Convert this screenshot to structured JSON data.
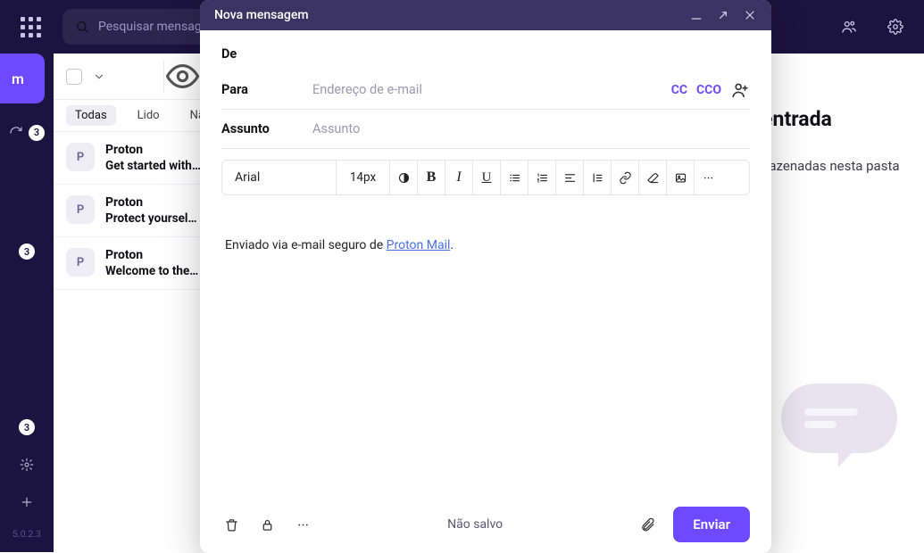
{
  "topbar": {
    "search_placeholder": "Pesquisar mensagens"
  },
  "sidebar": {
    "compose_label": "m",
    "badges": {
      "inbox": "3",
      "drafts": "3",
      "spam": "3"
    },
    "version": "5.0.2.3"
  },
  "list": {
    "tabs": {
      "all": "Todas",
      "read": "Lido",
      "unread": "Não"
    },
    "emails": [
      {
        "avatar": "P",
        "sender": "Proton",
        "subject": "Get started with Proton"
      },
      {
        "avatar": "P",
        "sender": "Proton",
        "subject": "Protect yourself online"
      },
      {
        "avatar": "P",
        "sender": "Proton",
        "subject": "Welcome to the future"
      }
    ]
  },
  "main": {
    "title_fragment": "e entrada",
    "subtitle_fragment": "armazenadas nesta pasta"
  },
  "composer": {
    "title": "Nova mensagem",
    "labels": {
      "from": "De",
      "to": "Para",
      "subject": "Assunto"
    },
    "placeholders": {
      "to": "Endereço de e-mail",
      "subject": "Assunto"
    },
    "cc": "CC",
    "bcc": "CCO",
    "font_name": "Arial",
    "font_size": "14px",
    "signature_prefix": "Enviado via e-mail seguro de ",
    "signature_link": "Proton Mail",
    "signature_suffix": ".",
    "save_state": "Não salvo",
    "send_label": "Enviar"
  }
}
